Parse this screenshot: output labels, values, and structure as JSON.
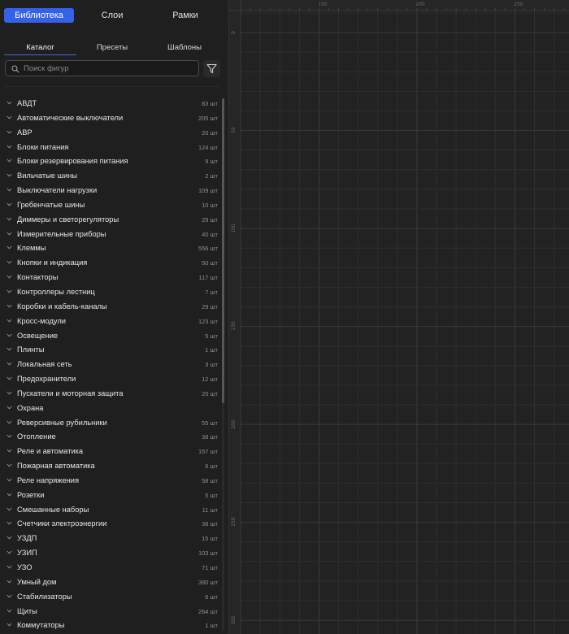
{
  "top_tabs": [
    {
      "label": "Библиотека",
      "active": true
    },
    {
      "label": "Слои",
      "active": false
    },
    {
      "label": "Рамки",
      "active": false
    }
  ],
  "sub_tabs": [
    {
      "label": "Каталог",
      "active": true
    },
    {
      "label": "Пресеты",
      "active": false
    },
    {
      "label": "Шаблоны",
      "active": false
    }
  ],
  "search": {
    "placeholder": "Поиск фигур",
    "value": "",
    "icon": "search-icon"
  },
  "filter": {
    "icon": "filter-icon"
  },
  "categories": [
    {
      "name": "АВДТ",
      "count": "83 шт"
    },
    {
      "name": "Автоматические выключатели",
      "count": "205 шт"
    },
    {
      "name": "АВР",
      "count": "20 шт"
    },
    {
      "name": "Блоки питания",
      "count": "124 шт"
    },
    {
      "name": "Блоки резервирования питания",
      "count": "9 шт"
    },
    {
      "name": "Вильчатые шины",
      "count": "2 шт"
    },
    {
      "name": "Выключатели нагрузки",
      "count": "109 шт"
    },
    {
      "name": "Гребенчатые шины",
      "count": "10 шт"
    },
    {
      "name": "Диммеры и светорегуляторы",
      "count": "29 шт"
    },
    {
      "name": "Измерительные приборы",
      "count": "40 шт"
    },
    {
      "name": "Клеммы",
      "count": "556 шт"
    },
    {
      "name": "Кнопки и индикация",
      "count": "50 шт"
    },
    {
      "name": "Контакторы",
      "count": "117 шт"
    },
    {
      "name": "Контроллеры лестниц",
      "count": "7 шт"
    },
    {
      "name": "Коробки и кабель-каналы",
      "count": "29 шт"
    },
    {
      "name": "Кросс-модули",
      "count": "123 шт"
    },
    {
      "name": "Освещение",
      "count": "5 шт"
    },
    {
      "name": "Плинты",
      "count": "1 шт"
    },
    {
      "name": "Локальная сеть",
      "count": "3 шт"
    },
    {
      "name": "Предохранители",
      "count": "12 шт"
    },
    {
      "name": "Пускатели и моторная защита",
      "count": "20 шт"
    },
    {
      "name": "Охрана",
      "count": ""
    },
    {
      "name": "Реверсивные рубильники",
      "count": "55 шт"
    },
    {
      "name": "Отопление",
      "count": "38 шт"
    },
    {
      "name": "Реле и автоматика",
      "count": "157 шт"
    },
    {
      "name": "Пожарная автоматика",
      "count": "6 шт"
    },
    {
      "name": "Реле напряжения",
      "count": "58 шт"
    },
    {
      "name": "Розетки",
      "count": "5 шт"
    },
    {
      "name": "Смешанные наборы",
      "count": "11 шт"
    },
    {
      "name": "Счетчики электроэнергии",
      "count": "38 шт"
    },
    {
      "name": "УЗДП",
      "count": "15 шт"
    },
    {
      "name": "УЗИП",
      "count": "103 шт"
    },
    {
      "name": "УЗО",
      "count": "71 шт"
    },
    {
      "name": "Умный дом",
      "count": "390 шт"
    },
    {
      "name": "Стабилизаторы",
      "count": "6 шт"
    },
    {
      "name": "Щиты",
      "count": "264 шт"
    },
    {
      "name": "Коммутаторы",
      "count": "1 шт"
    }
  ],
  "ruler": {
    "horizontal": [
      "150",
      "200",
      "250"
    ],
    "vertical": [
      "0",
      "50",
      "100",
      "150",
      "200",
      "250",
      "300"
    ]
  },
  "colors": {
    "accent": "#3361e8",
    "panel": "#1f1f1f",
    "canvas": "#222222",
    "grid_minor": "#2e2e2e",
    "grid_major": "#3a3a3a"
  }
}
